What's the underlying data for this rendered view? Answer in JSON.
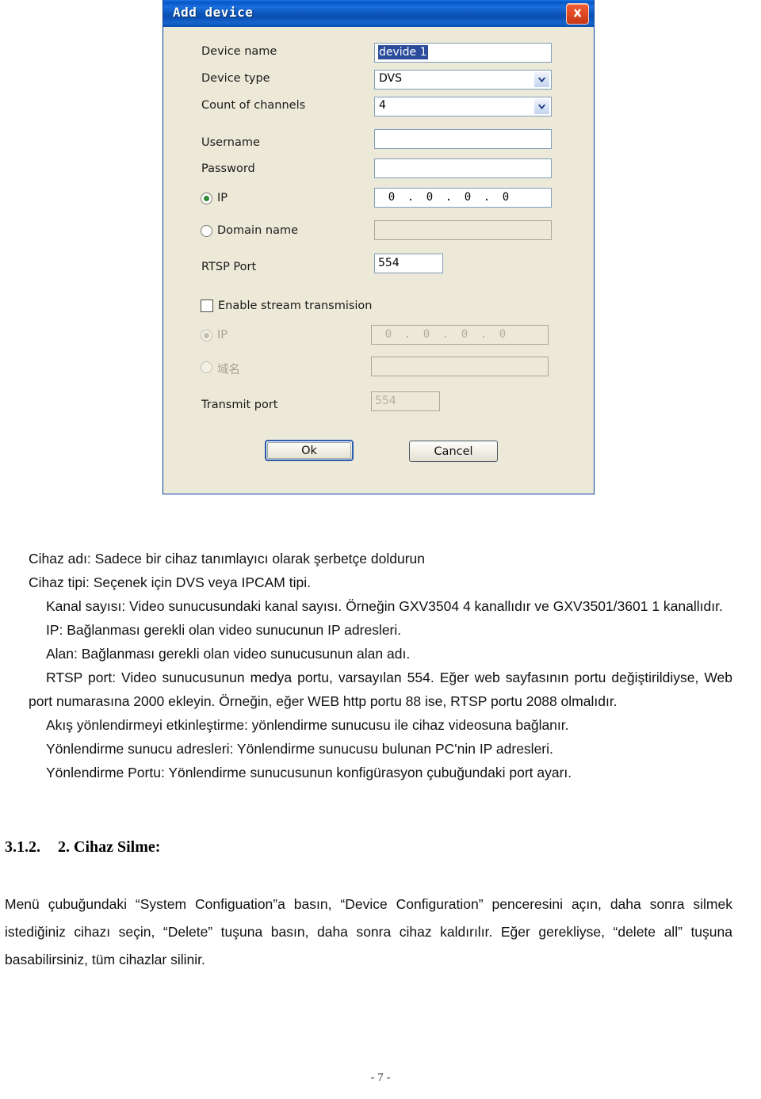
{
  "dialog": {
    "title": "Add device",
    "close_label": "×",
    "fields": [
      {
        "label": "Device name",
        "value": "devide 1",
        "type": "text-selected"
      },
      {
        "label": "Device type",
        "value": "DVS",
        "type": "combobox"
      },
      {
        "label": "Count of channels",
        "value": "4",
        "type": "combobox"
      },
      {
        "label": "Username",
        "value": "",
        "type": "text"
      },
      {
        "label": "Password",
        "value": "",
        "type": "text"
      }
    ],
    "ip_radio_label": "IP",
    "ip_octets": [
      "0",
      "0",
      "0",
      "0"
    ],
    "ip_separator": ".",
    "domain_radio_label": "Domain name",
    "domain_value": "",
    "rtsp_label": "RTSP Port",
    "rtsp_value": "554",
    "enable_stream_label": "Enable stream transmision",
    "stream_ip_label": "IP",
    "stream_ip_octets": [
      "0",
      "0",
      "0",
      "0"
    ],
    "stream_domain_label": "域名",
    "stream_domain_value": "",
    "transmit_port_label": "Transmit port",
    "transmit_port_value": "554",
    "ok_label": "Ok",
    "cancel_label": "Cancel",
    "colors": {
      "titlebar": "#0d56bb",
      "face": "#ece9d8",
      "field_border": "#7f9db9",
      "selection": "#2a4c9b",
      "close_button": "#e24a22",
      "radio_dot": "#2e8b33",
      "default_button_focus": "#2a5db0"
    }
  },
  "document": {
    "lines": [
      "Cihaz adı: Sadece bir cihaz tanımlayıcı olarak şerbetçe doldurun",
      "Cihaz tipi: Seçenek için DVS veya IPCAM tipi.",
      "Kanal sayısı: Video sunucusundaki kanal sayısı. Örneğin GXV3504 4 kanallıdır ve GXV3501/3601 1 kanallıdır.",
      "IP: Bağlanması gerekli olan video sunucunun IP adresleri.",
      "Alan: Bağlanması gerekli olan video sunucusunun alan adı.",
      "RTSP port: Video sunucusunun medya portu, varsayılan 554. Eğer web sayfasının portu değiştirildiyse, Web port numarasına 2000 ekleyin. Örneğin, eğer WEB http portu 88 ise, RTSP portu 2088 olmalıdır.",
      "Akış yönlendirmeyi etkinleştirme: yönlendirme sunucusu ile cihaz videosuna bağlanır.",
      "Yönlendirme sunucu adresleri: Yönlendirme sunucusu bulunan PC'nin IP adresleri.",
      "Yönlendirme Portu: Yönlendirme sunucusunun konfigürasyon çubuğundaki port ayarı."
    ],
    "heading_number": "3.1.2.",
    "heading_text": "2. Cihaz Silme:",
    "paragraph": "Menü çubuğundaki “System Configuation”a basın, “Device Configuration” penceresini açın, daha sonra silmek istediğiniz cihazı seçin, “Delete” tuşuna basın, daha sonra cihaz kaldırılır. Eğer gerekliyse, “delete all” tuşuna basabilirsiniz, tüm cihazlar silinir.",
    "footer": "- 7 -"
  }
}
